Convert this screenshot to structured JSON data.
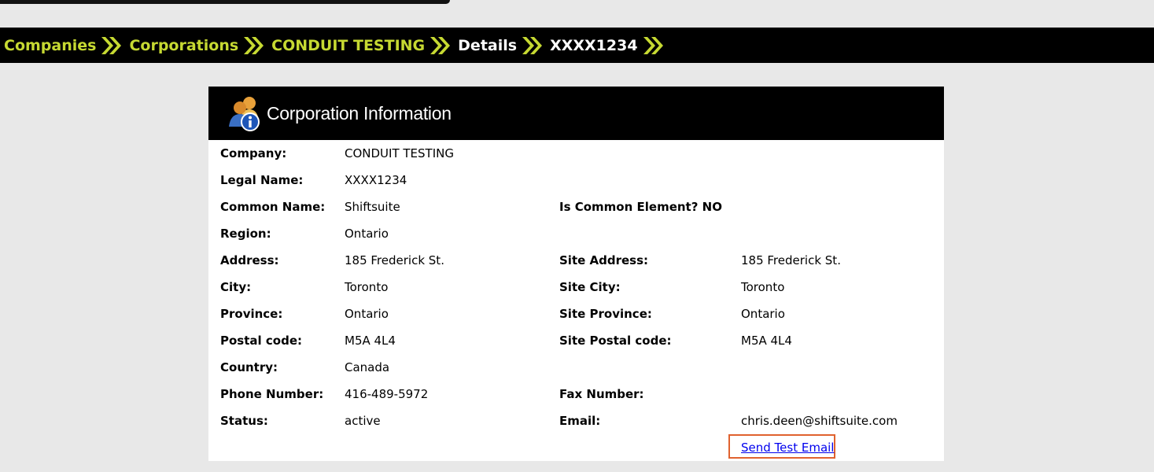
{
  "breadcrumb": [
    {
      "label": "Companies",
      "current": false
    },
    {
      "label": "Corporations",
      "current": false
    },
    {
      "label": "CONDUIT TESTING",
      "current": false
    },
    {
      "label": "Details",
      "current": true
    },
    {
      "label": "XXXX1234",
      "current": true
    }
  ],
  "colors": {
    "breadcrumb_link": "#c6d932",
    "breadcrumb_current": "#ffffff",
    "header_bg": "#000000",
    "highlight_box": "#e0622f"
  },
  "panel": {
    "title": "Corporation Information",
    "icon": "corporation-info-icon"
  },
  "fields": {
    "company": {
      "label": "Company:",
      "value": "CONDUIT TESTING"
    },
    "legal_name": {
      "label": "Legal Name:",
      "value": "XXXX1234"
    },
    "common_name": {
      "label": "Common Name:",
      "value": "Shiftsuite"
    },
    "is_common_element": {
      "label": "Is Common Element? NO"
    },
    "region": {
      "label": "Region:",
      "value": "Ontario"
    },
    "address": {
      "label": "Address:",
      "value": "185 Frederick St."
    },
    "site_address": {
      "label": "Site Address:",
      "value": "185 Frederick St."
    },
    "city": {
      "label": "City:",
      "value": "Toronto"
    },
    "site_city": {
      "label": "Site City:",
      "value": "Toronto"
    },
    "province": {
      "label": "Province:",
      "value": "Ontario"
    },
    "site_province": {
      "label": "Site Province:",
      "value": "Ontario"
    },
    "postal_code": {
      "label": "Postal code:",
      "value": "M5A 4L4"
    },
    "site_postal_code": {
      "label": "Site Postal code:",
      "value": "M5A 4L4"
    },
    "country": {
      "label": "Country:",
      "value": "Canada"
    },
    "phone": {
      "label": "Phone Number:",
      "value": "416-489-5972"
    },
    "fax": {
      "label": "Fax Number:",
      "value": ""
    },
    "status": {
      "label": "Status:",
      "value": "active"
    },
    "email": {
      "label": "Email:",
      "value": "chris.deen@shiftsuite.com"
    }
  },
  "actions": {
    "send_test_email": "Send Test Email"
  }
}
